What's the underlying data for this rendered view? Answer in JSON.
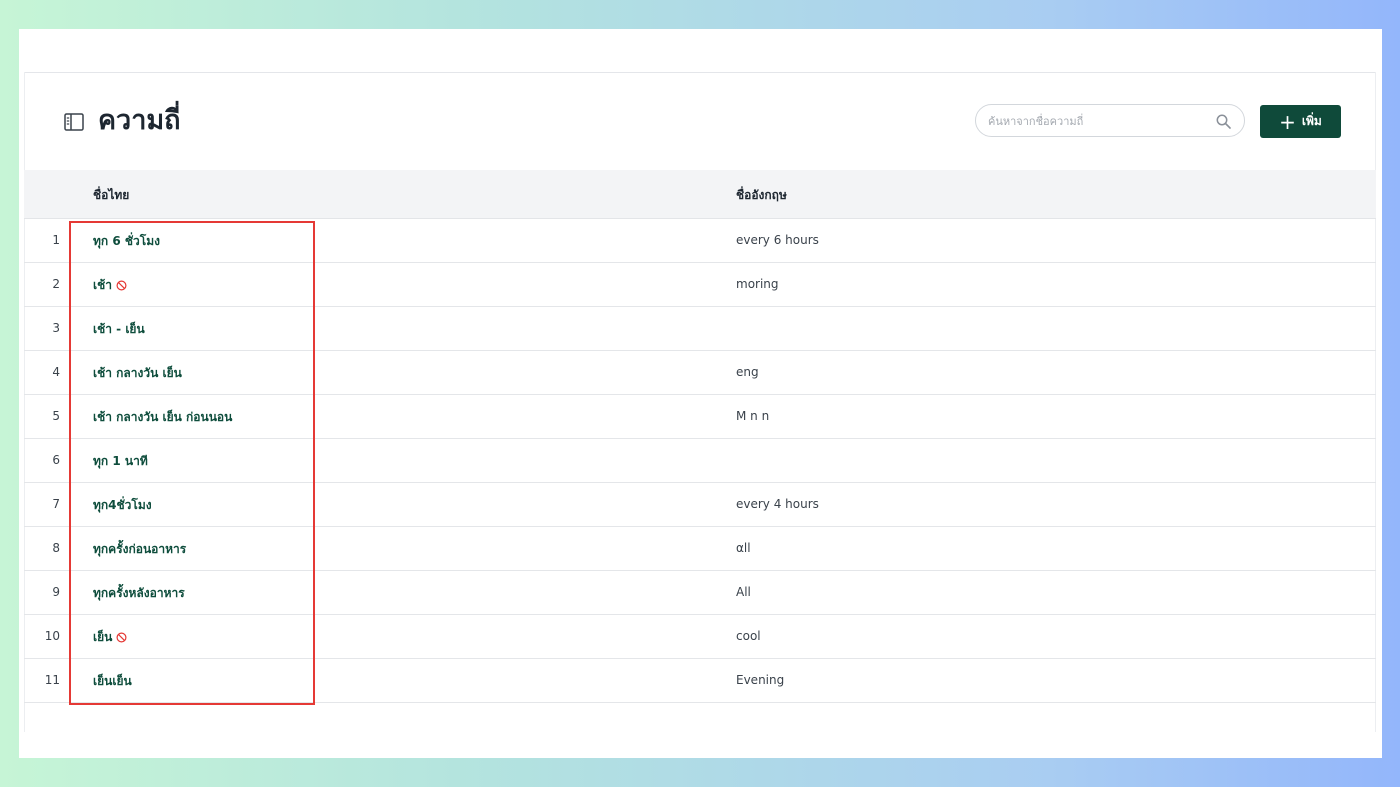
{
  "page": {
    "title": "ความถี่",
    "title_icon": "sidebar-panel-icon"
  },
  "search": {
    "placeholder": "ค้นหาจากชื่อความถี่",
    "icon": "search-icon"
  },
  "add_button": {
    "label": "เพิ่ม",
    "icon": "plus-icon",
    "color": "#0f4a3a"
  },
  "table": {
    "headers": {
      "thai": "ชื่อไทย",
      "english": "ชื่ออังกฤษ"
    },
    "rows": [
      {
        "num": "1",
        "thai": "ทุก 6 ชั่วโมง",
        "english": "every 6 hours",
        "inactive": false
      },
      {
        "num": "2",
        "thai": "เช้า",
        "english": "moring",
        "inactive": true
      },
      {
        "num": "3",
        "thai": "เช้า - เย็น",
        "english": "",
        "inactive": false
      },
      {
        "num": "4",
        "thai": "เช้า กลางวัน เย็น",
        "english": "eng",
        "inactive": false
      },
      {
        "num": "5",
        "thai": "เช้า กลางวัน เย็น ก่อนนอน",
        "english": "M n n",
        "inactive": false
      },
      {
        "num": "6",
        "thai": "ทุก 1 นาที",
        "english": "",
        "inactive": false
      },
      {
        "num": "7",
        "thai": "ทุก4ชั่วโมง",
        "english": "every 4 hours",
        "inactive": false
      },
      {
        "num": "8",
        "thai": "ทุกครั้งก่อนอาหาร",
        "english": "αll",
        "inactive": false
      },
      {
        "num": "9",
        "thai": "ทุกครั้งหลังอาหาร",
        "english": "All",
        "inactive": false
      },
      {
        "num": "10",
        "thai": "เย็น",
        "english": "cool",
        "inactive": true
      },
      {
        "num": "11",
        "thai": "เย็นเย็น",
        "english": "Evening",
        "inactive": false
      }
    ]
  },
  "colors": {
    "accent": "#0f4a3a",
    "thai_text": "#0e4d3c",
    "highlight": "#e53935",
    "inactive_icon": "#e53935"
  }
}
